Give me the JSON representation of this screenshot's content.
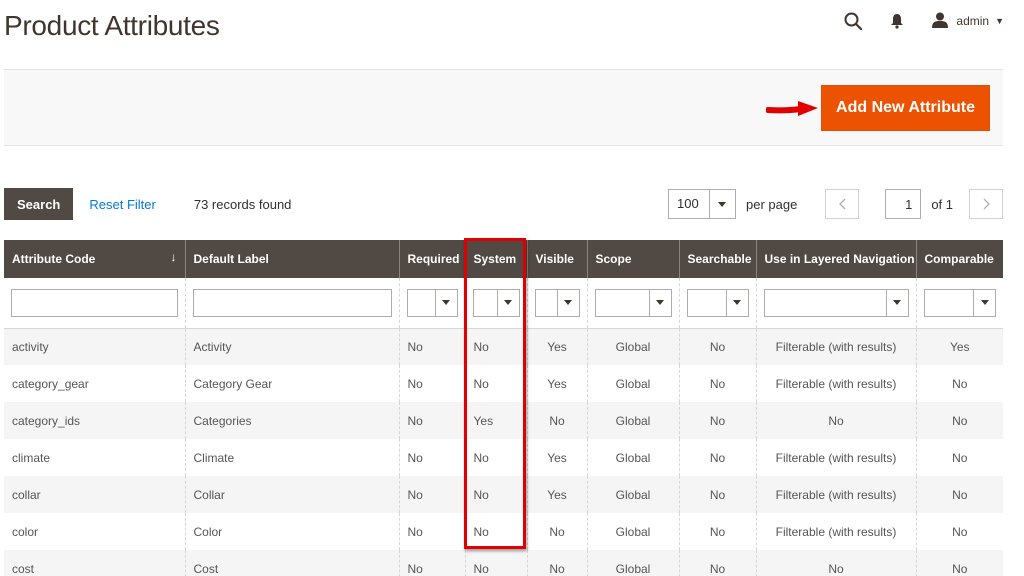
{
  "header": {
    "title": "Product Attributes",
    "admin_label": "admin"
  },
  "actions": {
    "add_new_label": "Add New Attribute",
    "accent_color": "#eb5202"
  },
  "toolbar": {
    "search_label": "Search",
    "reset_filter_label": "Reset Filter",
    "records_found": "73 records found",
    "per_page_value": "100",
    "per_page_label": "per page",
    "page_value": "1",
    "of_pages": "of 1"
  },
  "grid": {
    "columns": [
      "Attribute Code",
      "Default Label",
      "Required",
      "System",
      "Visible",
      "Scope",
      "Searchable",
      "Use in Layered Navigation",
      "Comparable"
    ],
    "rows": [
      [
        "activity",
        "Activity",
        "No",
        "No",
        "Yes",
        "Global",
        "No",
        "Filterable (with results)",
        "Yes"
      ],
      [
        "category_gear",
        "Category Gear",
        "No",
        "No",
        "Yes",
        "Global",
        "No",
        "Filterable (with results)",
        "No"
      ],
      [
        "category_ids",
        "Categories",
        "No",
        "Yes",
        "No",
        "Global",
        "No",
        "No",
        "No"
      ],
      [
        "climate",
        "Climate",
        "No",
        "No",
        "Yes",
        "Global",
        "No",
        "Filterable (with results)",
        "No"
      ],
      [
        "collar",
        "Collar",
        "No",
        "No",
        "Yes",
        "Global",
        "No",
        "Filterable (with results)",
        "No"
      ],
      [
        "color",
        "Color",
        "No",
        "No",
        "No",
        "Global",
        "No",
        "Filterable (with results)",
        "No"
      ],
      [
        "cost",
        "Cost",
        "No",
        "No",
        "No",
        "Global",
        "No",
        "No",
        "No"
      ]
    ]
  },
  "icons": {
    "header_search": "search-icon",
    "header_notifications": "bell-icon",
    "header_user": "user-icon",
    "sort": "sort-arrow-down-icon",
    "annotation_arrow": "red-arrow-icon",
    "annotation_box": "red-highlight-box"
  }
}
